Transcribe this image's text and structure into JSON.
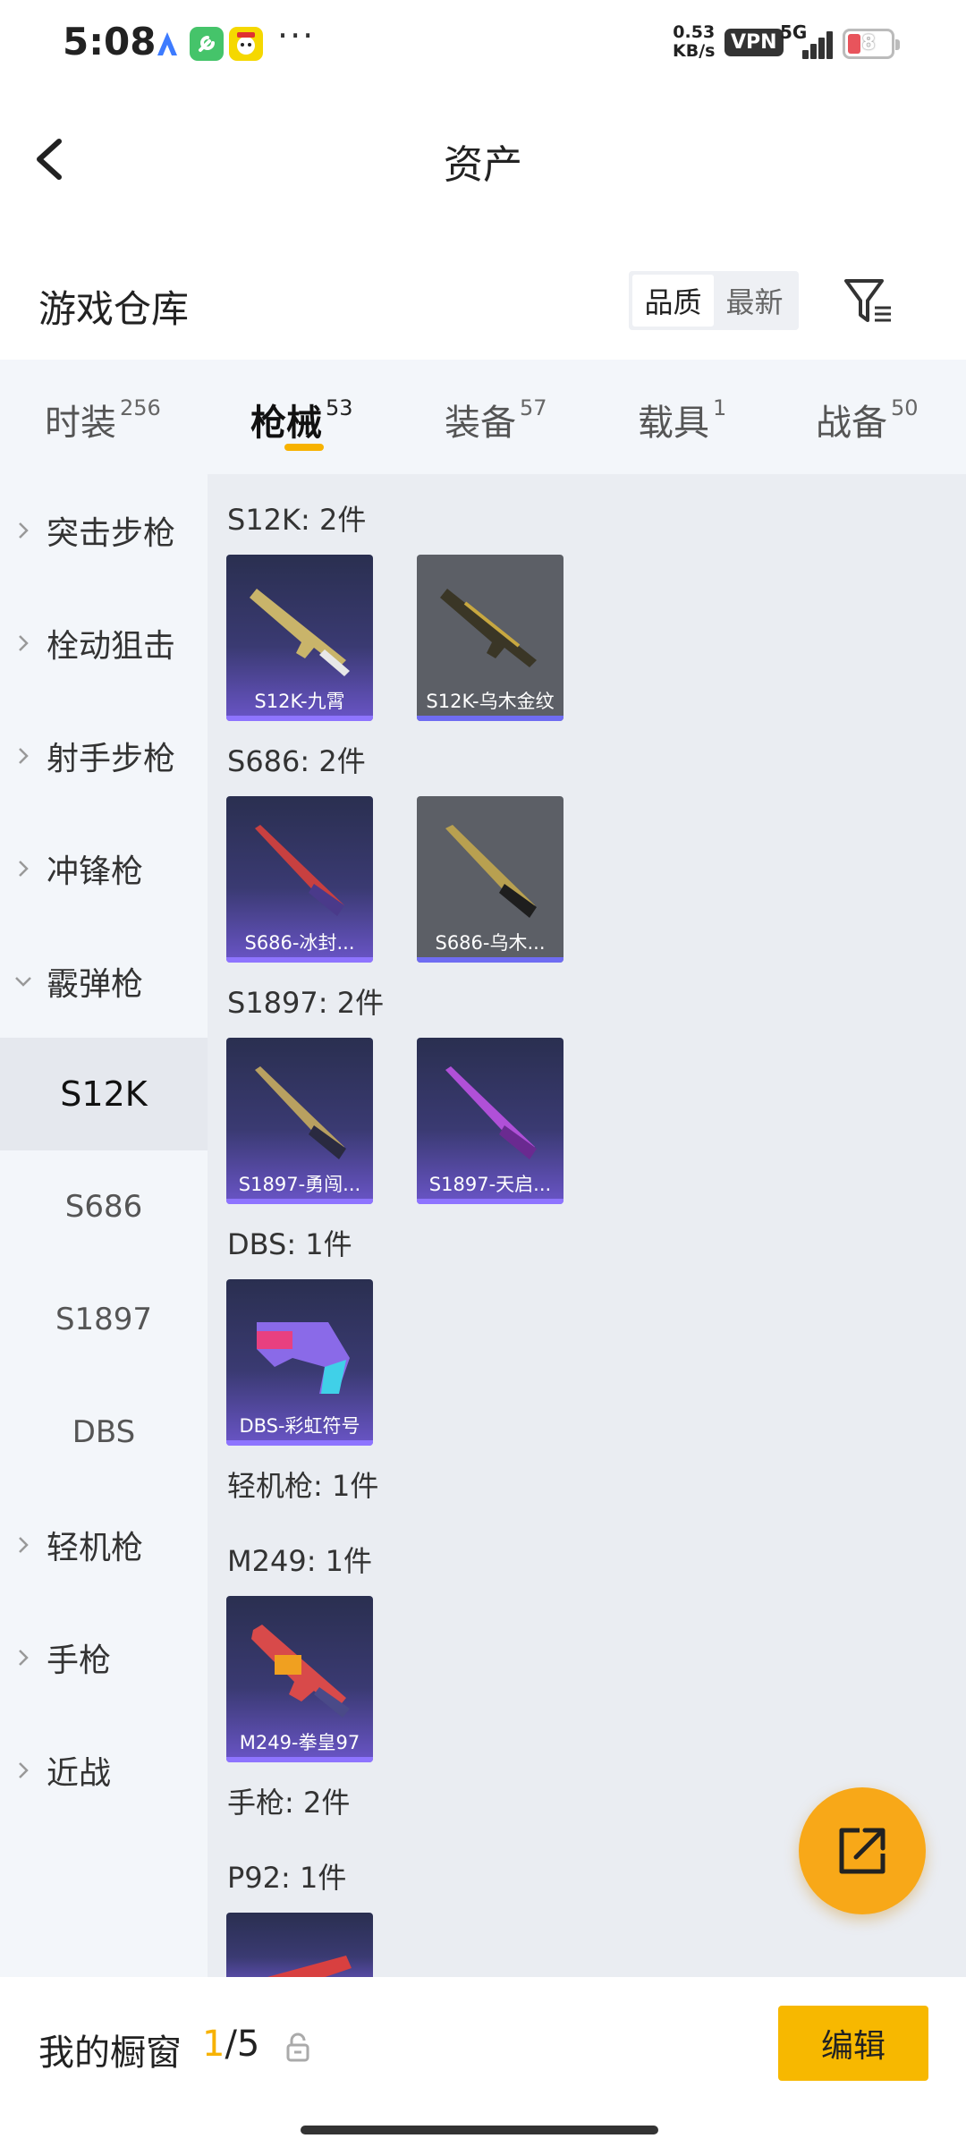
{
  "status_bar": {
    "time": "5:08",
    "net_speed_value": "0.53",
    "net_speed_unit": "KB/s",
    "vpn": "VPN",
    "network": "5G",
    "battery": "8"
  },
  "header": {
    "title": "资产",
    "back_icon": "chevron-left-icon"
  },
  "section": {
    "title": "游戏仓库"
  },
  "sort": {
    "options": [
      "品质",
      "最新"
    ],
    "selected": "品质"
  },
  "tabs": [
    {
      "label": "时装",
      "count": "256"
    },
    {
      "label": "枪械",
      "count": "53",
      "active": true
    },
    {
      "label": "装备",
      "count": "57"
    },
    {
      "label": "载具",
      "count": "1"
    },
    {
      "label": "战备",
      "count": "50"
    }
  ],
  "sidebar": {
    "items": [
      {
        "label": "突击步枪"
      },
      {
        "label": "栓动狙击"
      },
      {
        "label": "射手步枪"
      },
      {
        "label": "冲锋枪"
      },
      {
        "label": "霰弹枪",
        "expanded": true
      },
      {
        "label": "轻机枪"
      },
      {
        "label": "手枪"
      },
      {
        "label": "近战"
      }
    ],
    "subitems": [
      {
        "label": "S12K",
        "active": true
      },
      {
        "label": "S686"
      },
      {
        "label": "S1897"
      },
      {
        "label": "DBS"
      }
    ]
  },
  "groups": [
    {
      "label": "S12K: 2件",
      "items": [
        {
          "name": "S12K-九霄",
          "style": "purple"
        },
        {
          "name": "S12K-乌木金纹",
          "style": "gray"
        }
      ]
    },
    {
      "label": "S686: 2件",
      "items": [
        {
          "name": "S686-冰封...",
          "style": "purple"
        },
        {
          "name": "S686-乌木...",
          "style": "gray"
        }
      ]
    },
    {
      "label": "S1897: 2件",
      "items": [
        {
          "name": "S1897-勇闯...",
          "style": "purple"
        },
        {
          "name": "S1897-天启...",
          "style": "purple"
        }
      ]
    },
    {
      "label": "DBS: 1件",
      "items": [
        {
          "name": "DBS-彩虹符号",
          "style": "purple"
        }
      ]
    },
    {
      "label": "轻机枪: 1件"
    },
    {
      "label": "M249: 1件",
      "items": [
        {
          "name": "M249-拳皇97",
          "style": "purple"
        }
      ]
    },
    {
      "label": "手枪: 2件"
    },
    {
      "label": "P92: 1件",
      "items": [
        {
          "name": "",
          "style": "purple"
        }
      ]
    }
  ],
  "fab": {
    "icon": "external-link-icon"
  },
  "bottom": {
    "showcase_label": "我的橱窗",
    "count_current": "1",
    "count_total": "/5",
    "lock_icon": "lock-icon",
    "edit_label": "编辑"
  },
  "colors": {
    "accent": "#f7b200",
    "fab": "#f8a818",
    "card_purple": "#3a3a72",
    "card_gray": "#5c5f66",
    "rarity_bar": "#6f6cf2"
  }
}
